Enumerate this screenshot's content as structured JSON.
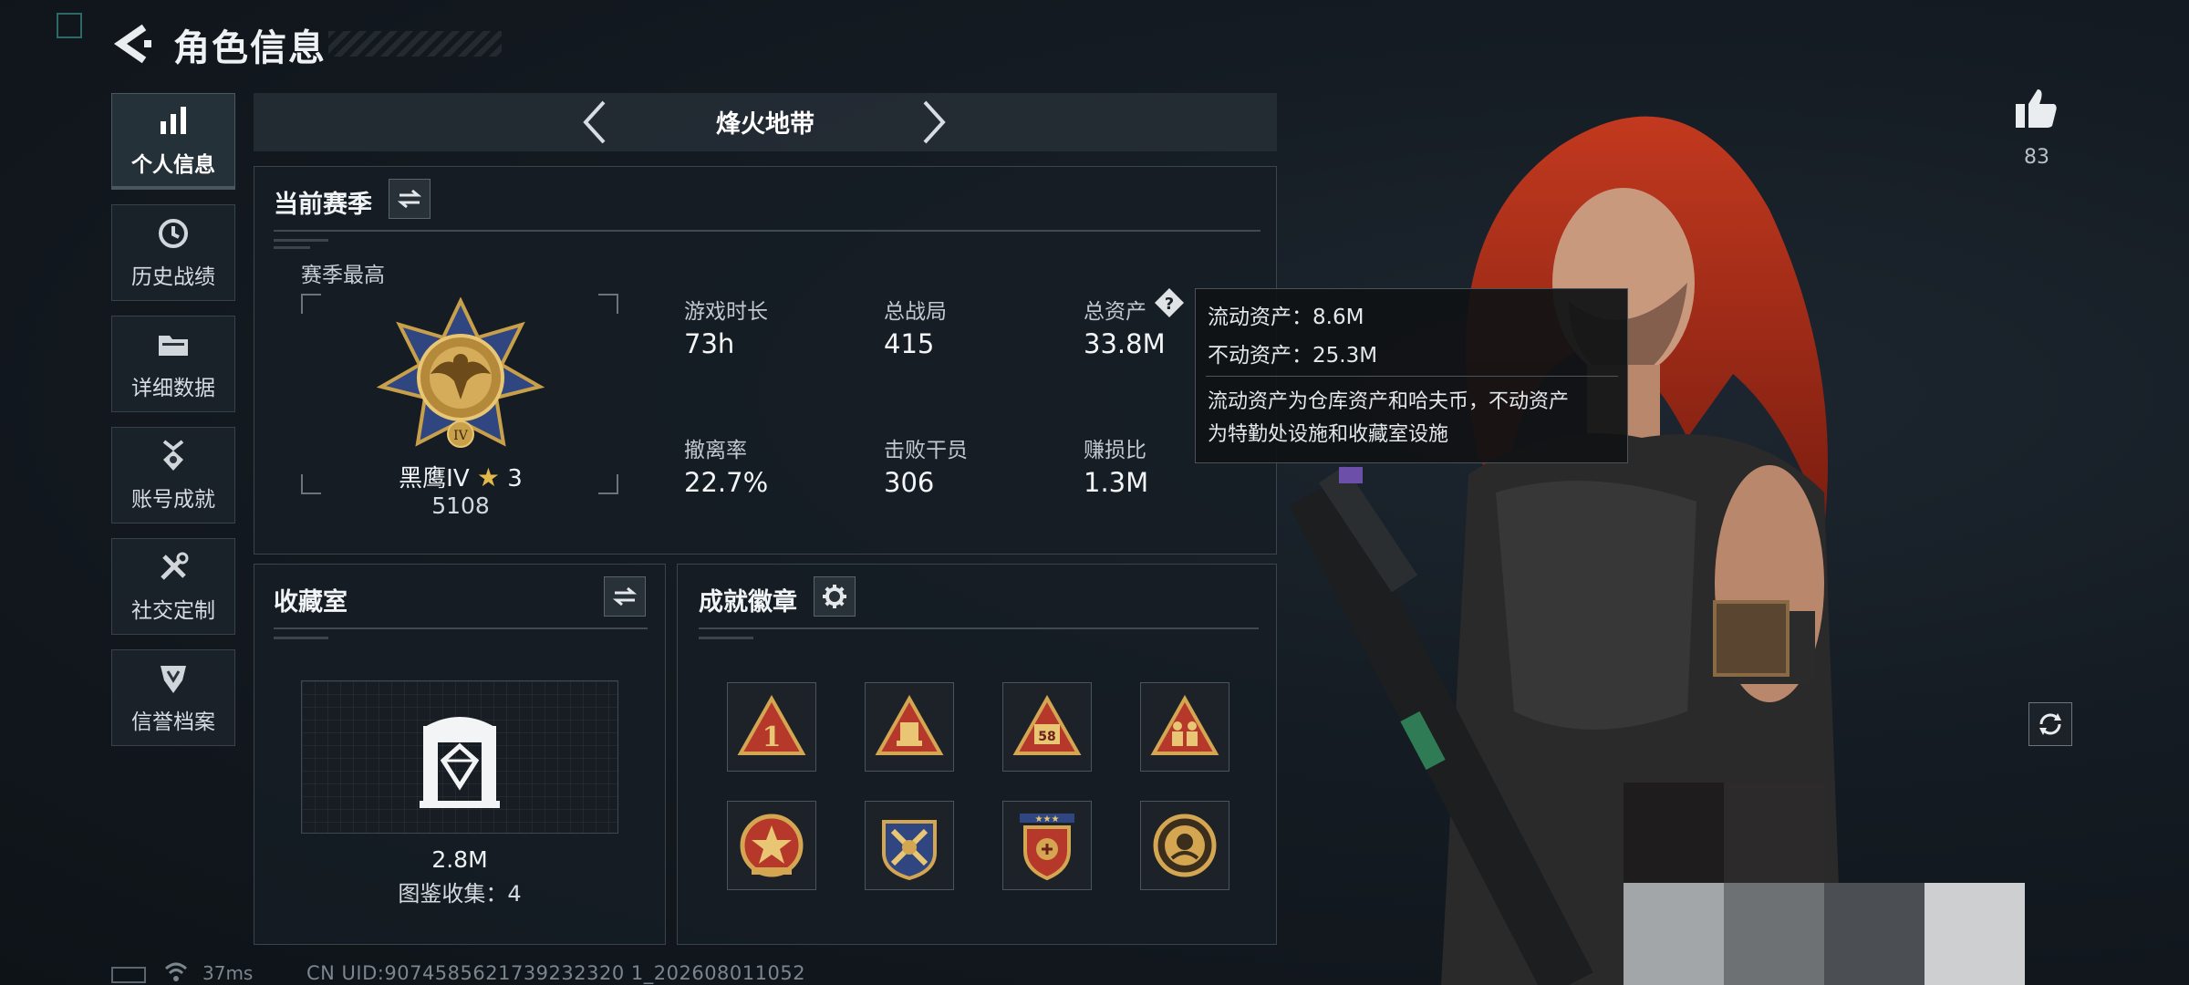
{
  "header": {
    "title": "角色信息"
  },
  "sidebar": {
    "items": [
      {
        "label": "个人信息",
        "icon": "bar-chart-icon",
        "active": true
      },
      {
        "label": "历史战绩",
        "icon": "history-clock-icon",
        "active": false
      },
      {
        "label": "详细数据",
        "icon": "folder-icon",
        "active": false
      },
      {
        "label": "账号成就",
        "icon": "medal-icon",
        "active": false
      },
      {
        "label": "社交定制",
        "icon": "tools-icon",
        "active": false
      },
      {
        "label": "信誉档案",
        "icon": "shield-badge-icon",
        "active": false
      }
    ]
  },
  "mode": {
    "title": "烽火地带"
  },
  "season": {
    "title": "当前赛季",
    "best_label": "赛季最高",
    "rank_name": "黑鹰IV",
    "rank_stars": "3",
    "rank_score": "5108",
    "stats": [
      {
        "label": "游戏时长",
        "value": "73h"
      },
      {
        "label": "总战局",
        "value": "415"
      },
      {
        "label": "总资产",
        "value": "33.8M"
      },
      {
        "label": "撤离率",
        "value": "22.7%"
      },
      {
        "label": "击败干员",
        "value": "306"
      },
      {
        "label": "赚损比",
        "value": "1.3M"
      }
    ]
  },
  "tooltip": {
    "line1": "流动资产：8.6M",
    "line2": "不动资产：25.3M",
    "desc1": "流动资产为仓库资产和哈夫币，不动资产",
    "desc2": "为特勤处设施和收藏室设施"
  },
  "collection": {
    "title": "收藏室",
    "value": "2.8M",
    "count_label": "图鉴收集：4"
  },
  "achievements": {
    "title": "成就徽章",
    "badges": [
      {
        "icon": "badge-rank-1-icon",
        "text": "1"
      },
      {
        "icon": "badge-supply-icon",
        "text": ""
      },
      {
        "icon": "badge-number-58-icon",
        "text": "58"
      },
      {
        "icon": "badge-soldiers-icon",
        "text": ""
      },
      {
        "icon": "badge-star-emblem-icon",
        "text": ""
      },
      {
        "icon": "badge-crossed-weapons-icon",
        "text": ""
      },
      {
        "icon": "badge-shield-stars-icon",
        "text": ""
      },
      {
        "icon": "badge-round-coin-icon",
        "text": ""
      }
    ]
  },
  "social": {
    "like_count": "83"
  },
  "footer": {
    "ping": "37ms",
    "uid": "CN UID:9074585621739232320 1_202608011052"
  },
  "colors": {
    "accent": "#2fd3a7",
    "gold": "#c9a04a",
    "badge_red": "#b5382a",
    "background": "#141b22"
  }
}
